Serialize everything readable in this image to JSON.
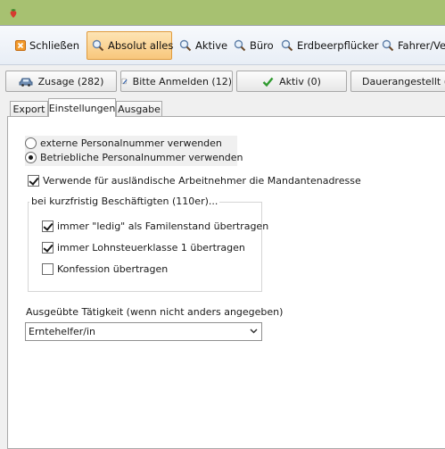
{
  "app": {
    "icon": "strawberry-icon"
  },
  "toolbar": {
    "items": [
      {
        "label": "Schließen",
        "icon": "close-icon",
        "active": false
      },
      {
        "label": "Absolut alles",
        "icon": "search-icon",
        "active": true
      },
      {
        "label": "Aktive",
        "icon": "search-icon",
        "active": false
      },
      {
        "label": "Büro",
        "icon": "search-icon",
        "active": false
      },
      {
        "label": "Erdbeerpflücker",
        "icon": "search-icon",
        "active": false
      },
      {
        "label": "Fahrer/Ver",
        "icon": "search-icon",
        "active": false
      }
    ]
  },
  "filters": [
    {
      "label": "Zusage (282)",
      "icon": "car-icon"
    },
    {
      "label": "Bitte Anmelden (12)",
      "icon": "pencil-icon"
    },
    {
      "label": "Aktiv (0)",
      "icon": "checkmark-icon"
    },
    {
      "label": "Dauerangestellt (",
      "icon": "checkmark-icon"
    }
  ],
  "tabs": [
    "Export",
    "Einstellungen",
    "Ausgabe"
  ],
  "settings": {
    "radio_external": "externe Personalnummer verwenden",
    "radio_internal": "Betriebliche Personalnummer verwenden",
    "radio_selected": "internal",
    "foreign_address": "Verwende für ausländische Arbeitnehmer die Mandantenadresse",
    "foreign_address_checked": true,
    "short_term_group": "bei kurzfristig Beschäftigten (110er)...",
    "ledig": "immer \"ledig\" als Familenstand übertragen",
    "ledig_checked": true,
    "steuerklasse": "immer Lohnsteuerklasse 1 übertragen",
    "steuerklasse_checked": true,
    "konfession": "Konfession übertragen",
    "konfession_checked": false,
    "activity_label": "Ausgeübte Tätigkeit (wenn nicht anders angegeben)",
    "activity_value": "Erntehelfer/in"
  },
  "colors": {
    "titlebar": "#a7c171",
    "active_button": "#f8c77c",
    "panel": "#ffffff"
  }
}
